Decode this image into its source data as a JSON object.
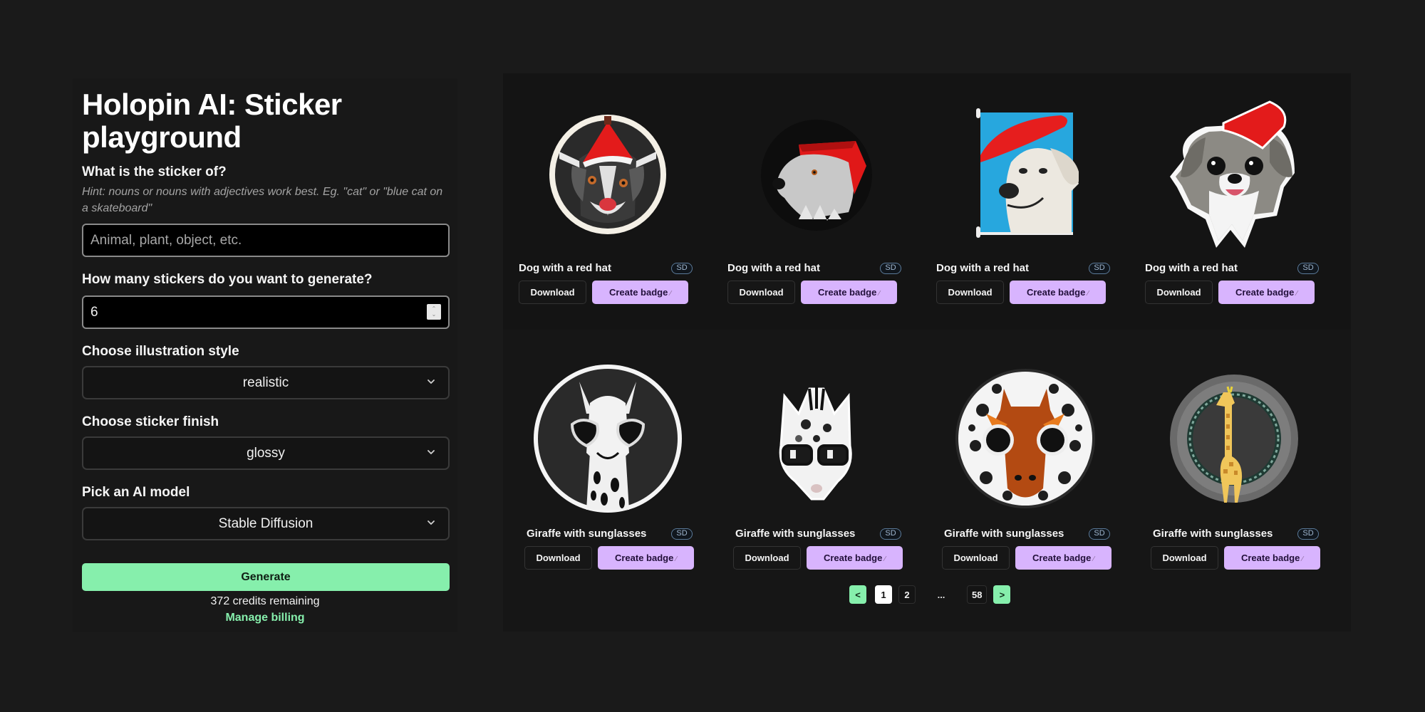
{
  "app": {
    "title": "Holopin AI: Sticker playground"
  },
  "form": {
    "subject": {
      "label": "What is the sticker of?",
      "hint": "Hint: nouns or nouns with adjectives work best. Eg. \"cat\" or \"blue cat on a skateboard\"",
      "value": "",
      "placeholder": "Animal, plant, object, etc."
    },
    "count": {
      "label": "How many stickers do you want to generate?",
      "value": "6"
    },
    "style": {
      "label": "Choose illustration style",
      "selected": "realistic"
    },
    "finish": {
      "label": "Choose sticker finish",
      "selected": "glossy"
    },
    "model": {
      "label": "Pick an AI model",
      "selected": "Stable Diffusion"
    },
    "generate_label": "Generate",
    "credits_text": "372 credits remaining",
    "billing_label": "Manage billing"
  },
  "gallery": {
    "download_label": "Download",
    "create_badge_label": "Create badge",
    "create_badge_icon": "magic-wand-icon",
    "cards": [
      {
        "title": "Dog with a red hat",
        "model_badge": "SD",
        "image": "dog-red-hat-circle-badge"
      },
      {
        "title": "Dog with a red hat",
        "model_badge": "SD",
        "image": "dog-red-hat-profile-dark-circle"
      },
      {
        "title": "Dog with a red hat",
        "model_badge": "SD",
        "image": "dog-red-beret-blue-frame"
      },
      {
        "title": "Dog with a red hat",
        "model_badge": "SD",
        "image": "fluffy-dog-red-hat-sticker"
      },
      {
        "title": "Giraffe with sunglasses",
        "model_badge": "SD",
        "image": "giraffe-heart-sunglasses-circle"
      },
      {
        "title": "Giraffe with sunglasses",
        "model_badge": "SD",
        "image": "giraffe-glasses-bw-sticker"
      },
      {
        "title": "Giraffe with sunglasses",
        "model_badge": "SD",
        "image": "giraffe-face-sunglasses-spotted-circle"
      },
      {
        "title": "Giraffe with sunglasses",
        "model_badge": "SD",
        "image": "giraffe-full-body-wreath"
      }
    ]
  },
  "pagination": {
    "prev": "<",
    "next": ">",
    "pages": [
      "1",
      "2"
    ],
    "ellipsis": "...",
    "last": "58",
    "current": "1"
  },
  "colors": {
    "accent_green": "#86efac",
    "accent_purple": "#d8b4fe",
    "background": "#1a1a1a"
  }
}
